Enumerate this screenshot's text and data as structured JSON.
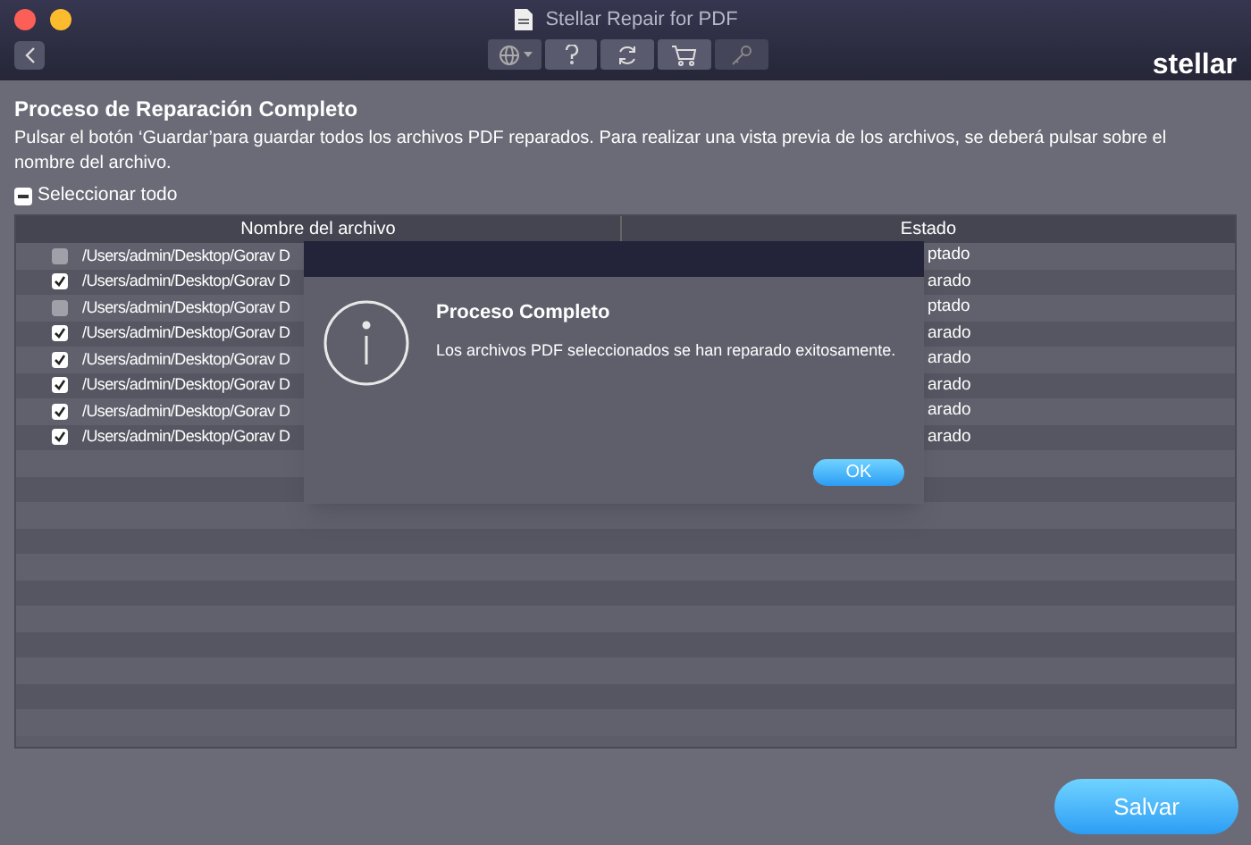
{
  "window": {
    "title": "Stellar Repair for PDF"
  },
  "toolbar": {
    "brand": "stellar"
  },
  "heading": "Proceso de Reparación Completo",
  "instructions": "Pulsar el botón  ‘Guardar’para guardar todos los archivos PDF reparados.  Para realizar una vista previa de los archivos, se deberá pulsar  sobre el nombre del archivo.",
  "select_all": {
    "label": "Seleccionar todo",
    "partial": true
  },
  "table": {
    "columns": [
      "Nombre del archivo",
      "Estado"
    ],
    "rows": [
      {
        "checked": false,
        "file": "/Users/admin/Desktop/Gorav D",
        "status": "ptado"
      },
      {
        "checked": true,
        "file": "/Users/admin/Desktop/Gorav D",
        "status": "arado"
      },
      {
        "checked": false,
        "file": "/Users/admin/Desktop/Gorav D",
        "status": "ptado"
      },
      {
        "checked": true,
        "file": "/Users/admin/Desktop/Gorav D",
        "status": "arado"
      },
      {
        "checked": true,
        "file": "/Users/admin/Desktop/Gorav D",
        "status": "arado"
      },
      {
        "checked": true,
        "file": "/Users/admin/Desktop/Gorav D",
        "status": "arado"
      },
      {
        "checked": true,
        "file": "/Users/admin/Desktop/Gorav D",
        "status": "arado"
      },
      {
        "checked": true,
        "file": "/Users/admin/Desktop/Gorav D",
        "status": "arado"
      }
    ]
  },
  "dialog": {
    "title": "Proceso Completo",
    "message": "Los archivos PDF seleccionados se han reparado exitosamente.",
    "button": "OK"
  },
  "save_button": "Salvar"
}
